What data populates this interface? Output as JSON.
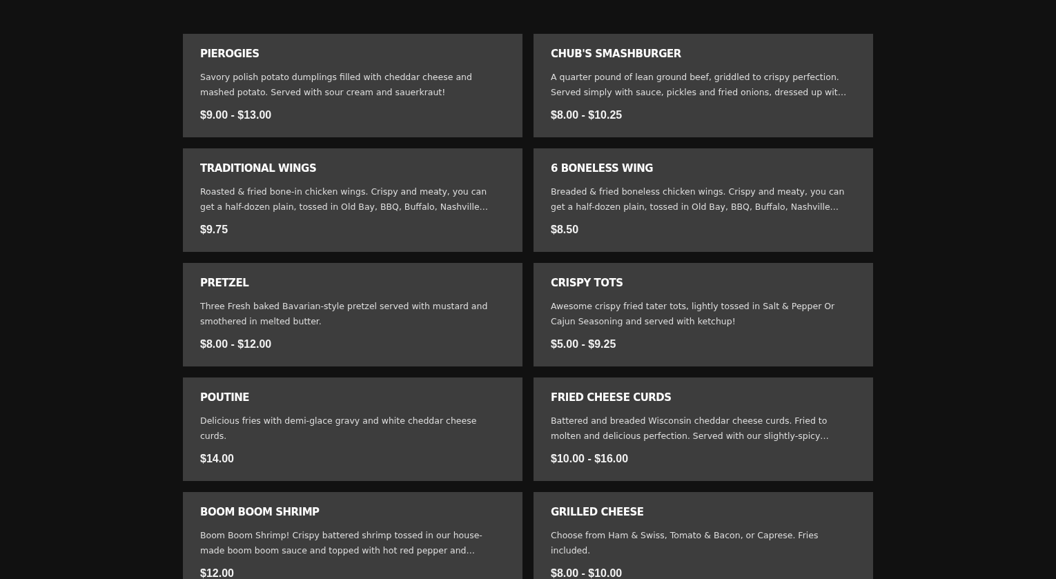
{
  "menu_items": [
    {
      "name": "PIEROGIES",
      "description": "Savory polish potato dumplings filled with cheddar cheese and mashed potato. Served with sour cream and sauerkraut!",
      "price": "$9.00 - $13.00"
    },
    {
      "name": "CHUB'S SMASHBURGER",
      "description": "A quarter pound of lean ground beef, griddled to crispy perfection. Served simply with sauce, pickles and fried onions, dressed up wit…",
      "price": "$8.00 - $10.25"
    },
    {
      "name": "TRADITIONAL WINGS",
      "description": "Roasted & fried bone-in chicken wings. Crispy and meaty, you can get a half-dozen plain, tossed in Old Bay, BBQ, Buffalo, Nashville…",
      "price": "$9.75"
    },
    {
      "name": "6 BONELESS WING",
      "description": "Breaded & fried boneless chicken wings. Crispy and meaty, you can get a half-dozen plain, tossed in Old Bay, BBQ, Buffalo, Nashville…",
      "price": "$8.50"
    },
    {
      "name": "PRETZEL",
      "description": "Three Fresh baked Bavarian-style pretzel served with mustard and smothered in melted butter.",
      "price": "$8.00 - $12.00"
    },
    {
      "name": "CRISPY TOTS",
      "description": "Awesome crispy fried tater tots, lightly tossed in Salt & Pepper Or Cajun Seasoning and served with ketchup!",
      "price": "$5.00 - $9.25"
    },
    {
      "name": "POUTINE",
      "description": "Delicious fries with demi-glace gravy and white cheddar cheese curds.",
      "price": "$14.00"
    },
    {
      "name": "FRIED CHEESE CURDS",
      "description": "Battered and breaded Wisconsin cheddar cheese curds. Fried to molten and delicious perfection. Served with our slightly-spicy…",
      "price": "$10.00 - $16.00"
    },
    {
      "name": "BOOM BOOM SHRIMP",
      "description": "Boom Boom Shrimp! Crispy battered shrimp tossed in our house-made boom boom sauce and topped with hot red pepper and…",
      "price": "$12.00"
    },
    {
      "name": "GRILLED CHEESE",
      "description": "Choose from Ham & Swiss, Tomato & Bacon, or Caprese. Fries included.",
      "price": "$8.00 - $10.00"
    }
  ]
}
